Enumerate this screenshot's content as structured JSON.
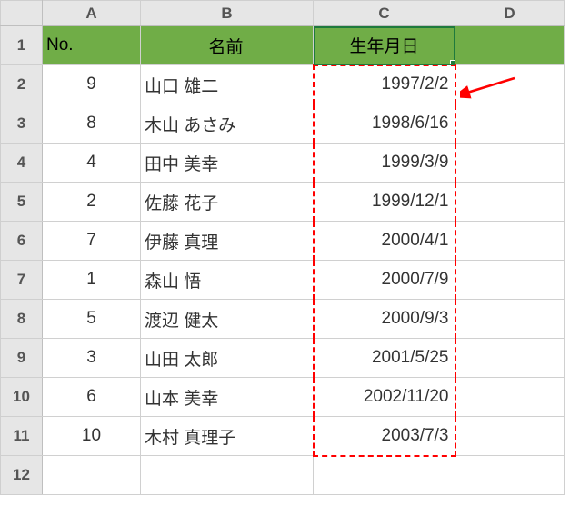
{
  "columns": [
    "A",
    "B",
    "C",
    "D"
  ],
  "row_numbers": [
    1,
    2,
    3,
    4,
    5,
    6,
    7,
    8,
    9,
    10,
    11,
    12
  ],
  "header": {
    "no": "No.",
    "name": "名前",
    "dob": "生年月日"
  },
  "rows": [
    {
      "no": "9",
      "name": "山口 雄二",
      "dob": "1997/2/2"
    },
    {
      "no": "8",
      "name": "木山 あさみ",
      "dob": "1998/6/16"
    },
    {
      "no": "4",
      "name": "田中 美幸",
      "dob": "1999/3/9"
    },
    {
      "no": "2",
      "name": "佐藤 花子",
      "dob": "1999/12/1"
    },
    {
      "no": "7",
      "name": "伊藤 真理",
      "dob": "2000/4/1"
    },
    {
      "no": "1",
      "name": "森山 悟",
      "dob": "2000/7/9"
    },
    {
      "no": "5",
      "name": "渡辺 健太",
      "dob": "2000/9/3"
    },
    {
      "no": "3",
      "name": "山田 太郎",
      "dob": "2001/5/25"
    },
    {
      "no": "6",
      "name": "山本 美幸",
      "dob": "2002/11/20"
    },
    {
      "no": "10",
      "name": "木村 真理子",
      "dob": "2003/7/3"
    }
  ],
  "chart_data": {
    "type": "table",
    "title": "",
    "columns": [
      "No.",
      "名前",
      "生年月日"
    ],
    "data": [
      [
        9,
        "山口 雄二",
        "1997/2/2"
      ],
      [
        8,
        "木山 あさみ",
        "1998/6/16"
      ],
      [
        4,
        "田中 美幸",
        "1999/3/9"
      ],
      [
        2,
        "佐藤 花子",
        "1999/12/1"
      ],
      [
        7,
        "伊藤 真理",
        "2000/4/1"
      ],
      [
        1,
        "森山 悟",
        "2000/7/9"
      ],
      [
        5,
        "渡辺 健太",
        "2000/9/3"
      ],
      [
        3,
        "山田 太郎",
        "2001/5/25"
      ],
      [
        6,
        "山本 美幸",
        "2002/11/20"
      ],
      [
        10,
        "木村 真理子",
        "2003/7/3"
      ]
    ]
  },
  "annotations": {
    "arrow_target": "C2"
  }
}
